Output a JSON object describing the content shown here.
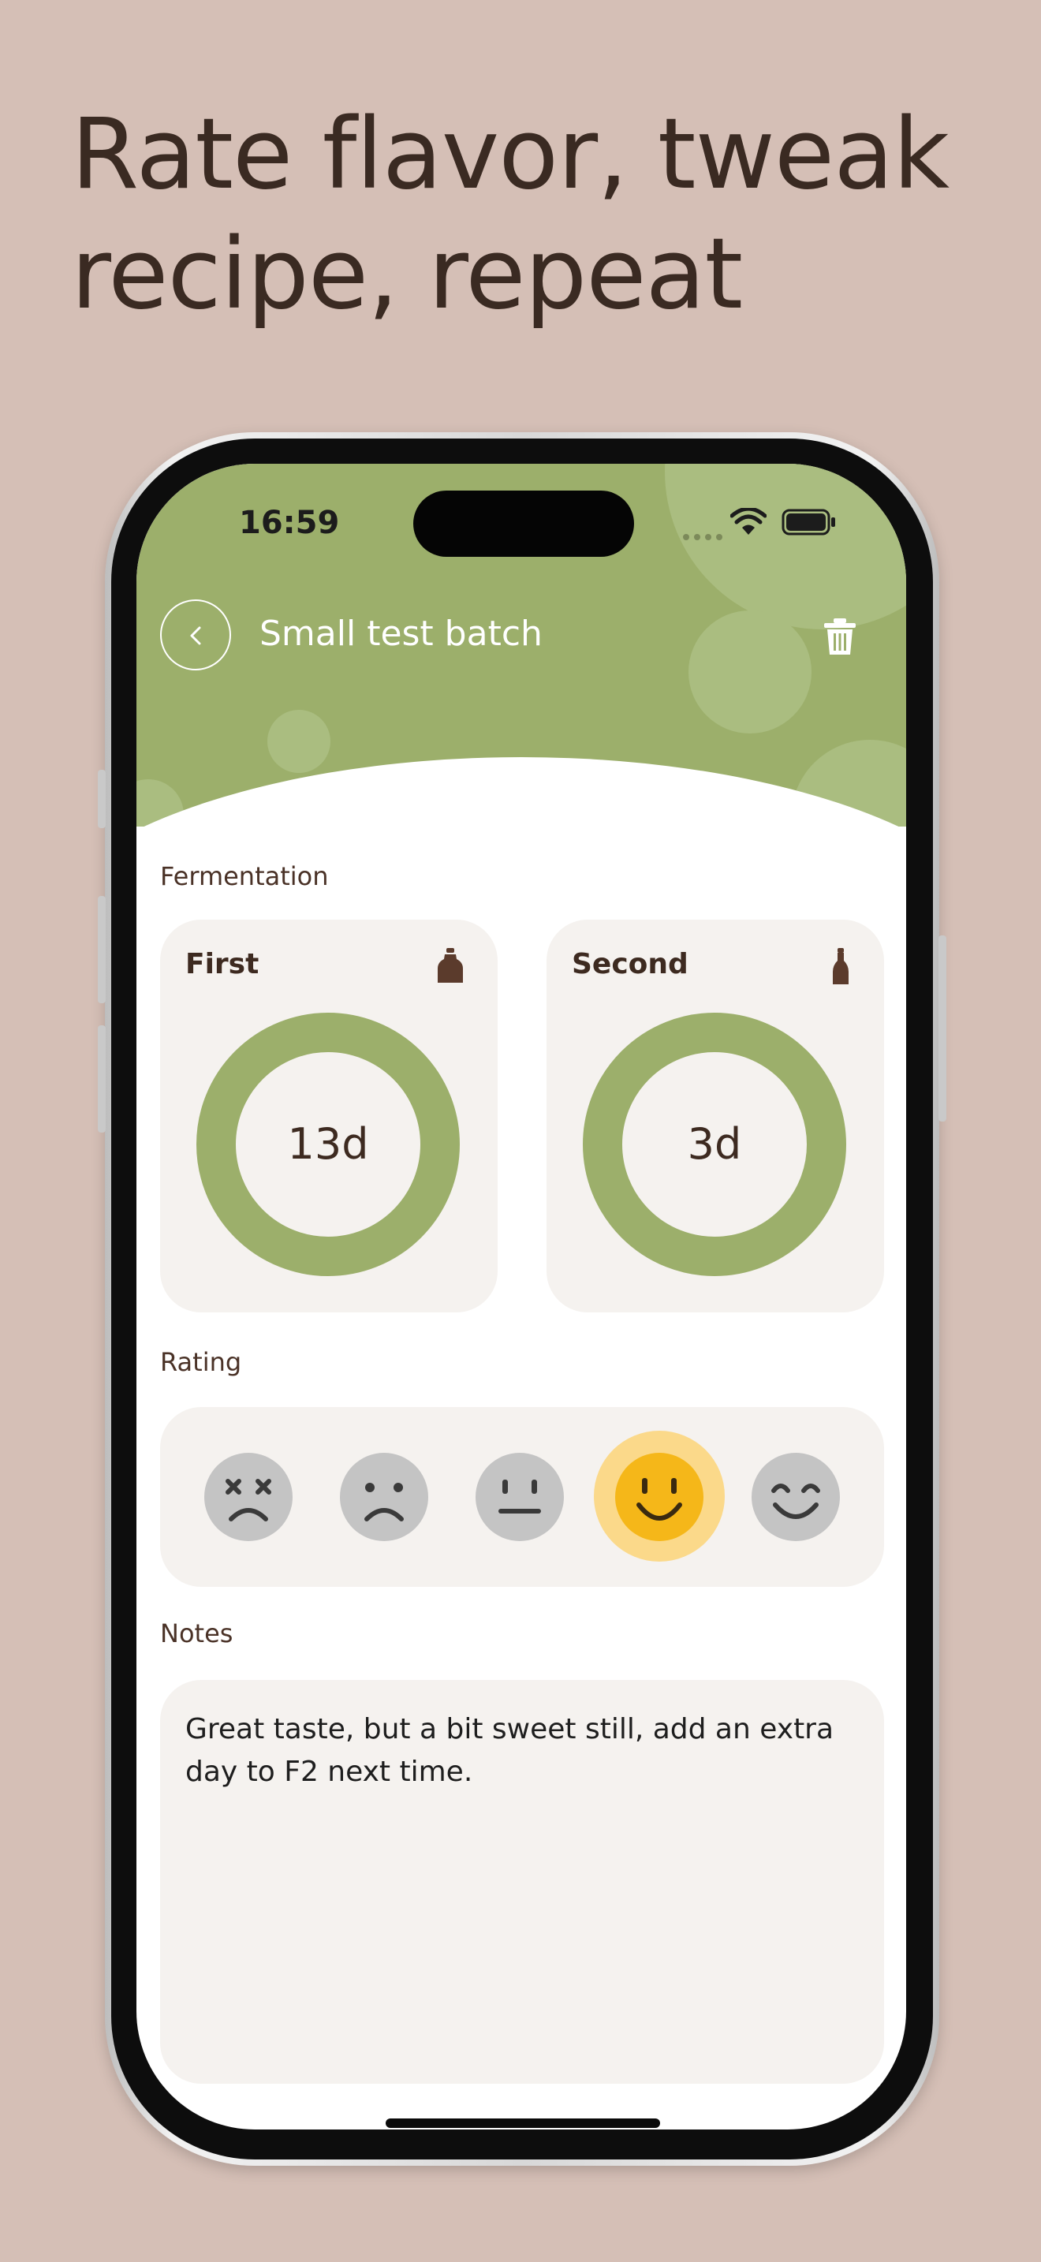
{
  "headline": {
    "line1": "Rate flavor, tweak",
    "line2": "recipe, repeat"
  },
  "status_bar": {
    "time": "16:59"
  },
  "header": {
    "title": "Small test batch"
  },
  "fermentation": {
    "section_label": "Fermentation",
    "first": {
      "label": "First",
      "value": "13d",
      "icon": "jar-icon"
    },
    "second": {
      "label": "Second",
      "value": "3d",
      "icon": "bottle-icon"
    }
  },
  "rating": {
    "section_label": "Rating",
    "options": [
      "dizzy-face-icon",
      "frown-face-icon",
      "neutral-face-icon",
      "smile-face-icon",
      "happy-face-icon"
    ],
    "selected_index": 3
  },
  "notes": {
    "section_label": "Notes",
    "text": "Great taste, but a bit sweet still, add an extra day to F2 next time."
  },
  "colors": {
    "background": "#d5bfb6",
    "header_green": "#9caf6b",
    "ring_green": "#9caf6b",
    "card": "#f5f2ef",
    "text_dark": "#3d2a20",
    "selected_face": "#f5b719",
    "selected_halo": "#fbd98a",
    "unselected_face": "#c4c4c4"
  }
}
